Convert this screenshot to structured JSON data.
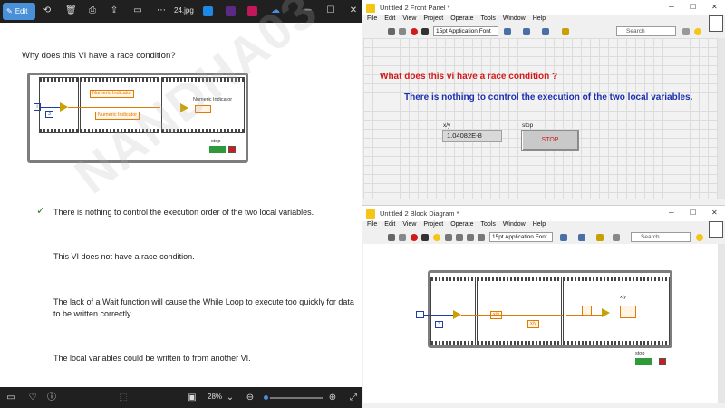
{
  "viewer": {
    "toolbar": {
      "edit_label": "Edit",
      "filename": "24.jpg"
    },
    "question": "Why does this VI have a race condition?",
    "answers": [
      "There is nothing to control the execution order of the two local variables.",
      "This VI does not have a race condition.",
      "The lack of a Wait function will cause the While Loop to execute too quickly for data",
      "to be written correctly.",
      "The local variables could be written to from another VI."
    ],
    "watermark": "NANDHA03",
    "diagram": {
      "indicator1": "Numeric Indicator",
      "indicator2": "Numeric Indicator",
      "indicator3_label": "Numeric Indicator",
      "const_i": "i",
      "const_3": "3",
      "stop_label": "stop"
    },
    "status": {
      "zoom": "28%",
      "zoom_fraction": 0.05
    }
  },
  "front_panel": {
    "title": "Untitled 2 Front Panel *",
    "menu": [
      "File",
      "Edit",
      "View",
      "Project",
      "Operate",
      "Tools",
      "Window",
      "Help"
    ],
    "font": "15pt Application Font",
    "search_placeholder": "Search",
    "question": "What does this vi have a race condition ?",
    "answer": "There is nothing to control the execution of the two local variables.",
    "xy_label": "x/y",
    "xy_value": "1.04082E-8",
    "stop_label": "stop",
    "stop_button": "STOP"
  },
  "block_diagram": {
    "title": "Untitled 2 Block Diagram *",
    "menu": [
      "File",
      "Edit",
      "View",
      "Project",
      "Operate",
      "Tools",
      "Window",
      "Help"
    ],
    "font": "15pt Application Font",
    "search_placeholder": "Search",
    "xy_label": "x/y",
    "local1": "x/y",
    "local2": "x/y",
    "const_i": "i",
    "const_3": "3",
    "stop_label": "stop"
  },
  "colors": {
    "question_red": "#d11a1a",
    "answer_blue": "#1b2fb0",
    "wire_orange": "#e07b00",
    "wire_blue": "#1f3ea3",
    "accent": "#4a90d9"
  }
}
